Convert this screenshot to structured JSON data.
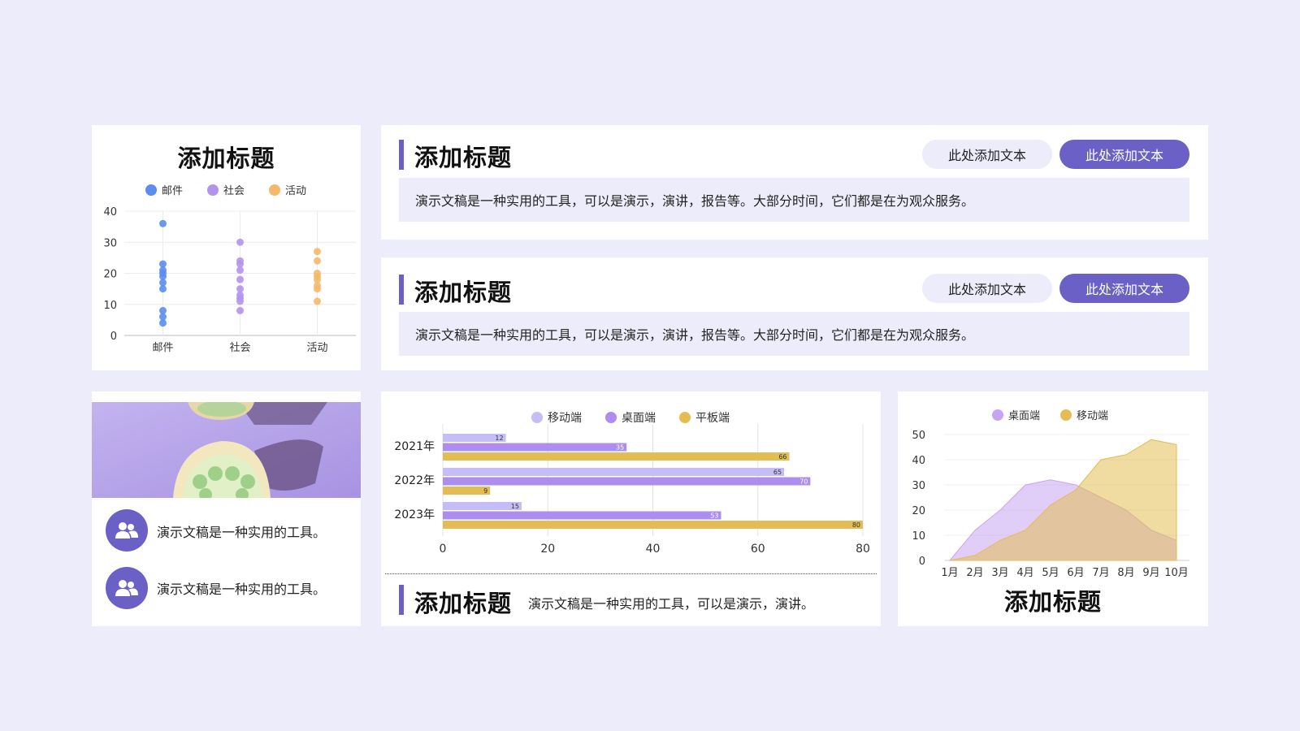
{
  "scatter_panel": {
    "title": "添加标题"
  },
  "row1": {
    "title": "添加标题",
    "btn_light": "此处添加文本",
    "btn_dark": "此处添加文本",
    "description": "演示文稿是一种实用的工具，可以是演示，演讲，报告等。大部分时间，它们都是在为观众服务。"
  },
  "row2": {
    "title": "添加标题",
    "btn_light": "此处添加文本",
    "btn_dark": "此处添加文本",
    "description": "演示文稿是一种实用的工具，可以是演示，演讲，报告等。大部分时间，它们都是在为观众服务。"
  },
  "image_panel": {
    "items": [
      {
        "text": "演示文稿是一种实用的工具。",
        "icon": "users-icon"
      },
      {
        "text": "演示文稿是一种实用的工具。",
        "icon": "users-icon"
      }
    ]
  },
  "bar_panel": {
    "title": "添加标题",
    "caption": "演示文稿是一种实用的工具，可以是演示，演讲。"
  },
  "area_panel": {
    "title": "添加标题"
  },
  "colors": {
    "accent": "#6a60c6",
    "background": "#edecfb",
    "blue": "#5b8def",
    "purple": "#b493ef",
    "orange": "#f5b96a",
    "lavender": "#c5bdf5",
    "violet": "#ae8df0",
    "gold": "#e3bd54"
  },
  "chart_data": [
    {
      "type": "scatter",
      "title": "添加标题",
      "categories": [
        "邮件",
        "社会",
        "活动"
      ],
      "ylim": [
        0,
        40
      ],
      "yticks": [
        0,
        10,
        20,
        30,
        40
      ],
      "legend_position": "top-center",
      "grid": true,
      "series": [
        {
          "name": "邮件",
          "color": "#5b8def",
          "x": "邮件",
          "values": [
            36,
            23,
            21,
            20,
            19,
            17,
            15,
            8,
            6,
            4
          ]
        },
        {
          "name": "社会",
          "color": "#b493ef",
          "x": "社会",
          "values": [
            30,
            24,
            23,
            21,
            18,
            15,
            13,
            12,
            11,
            8
          ]
        },
        {
          "name": "活动",
          "color": "#f5b96a",
          "x": "活动",
          "values": [
            27,
            24,
            20,
            19,
            18,
            16,
            15,
            11
          ]
        }
      ]
    },
    {
      "type": "bar",
      "orientation": "horizontal",
      "categories": [
        "2021年",
        "2022年",
        "2023年"
      ],
      "xlim": [
        0,
        80
      ],
      "xticks": [
        0,
        20,
        40,
        60,
        80
      ],
      "legend_position": "top-center",
      "grid": true,
      "series": [
        {
          "name": "移动端",
          "color": "#c5bdf5",
          "values": [
            12,
            65,
            15
          ]
        },
        {
          "name": "桌面端",
          "color": "#ae8df0",
          "values": [
            35,
            70,
            53
          ]
        },
        {
          "name": "平板端",
          "color": "#e3bd54",
          "values": [
            66,
            9,
            80
          ]
        }
      ]
    },
    {
      "type": "area",
      "title": "添加标题",
      "categories": [
        "1月",
        "2月",
        "3月",
        "4月",
        "5月",
        "6月",
        "7月",
        "8月",
        "9月",
        "10月"
      ],
      "ylim": [
        0,
        50
      ],
      "yticks": [
        0,
        10,
        20,
        30,
        40,
        50
      ],
      "legend_position": "top-center",
      "grid": true,
      "series": [
        {
          "name": "桌面端",
          "color": "#c6a5f2",
          "values": [
            0,
            12,
            20,
            30,
            32,
            30,
            25,
            20,
            12,
            8
          ]
        },
        {
          "name": "移动端",
          "color": "#e3bd54",
          "values": [
            0,
            2,
            8,
            12,
            22,
            28,
            40,
            42,
            48,
            46
          ]
        }
      ]
    }
  ]
}
